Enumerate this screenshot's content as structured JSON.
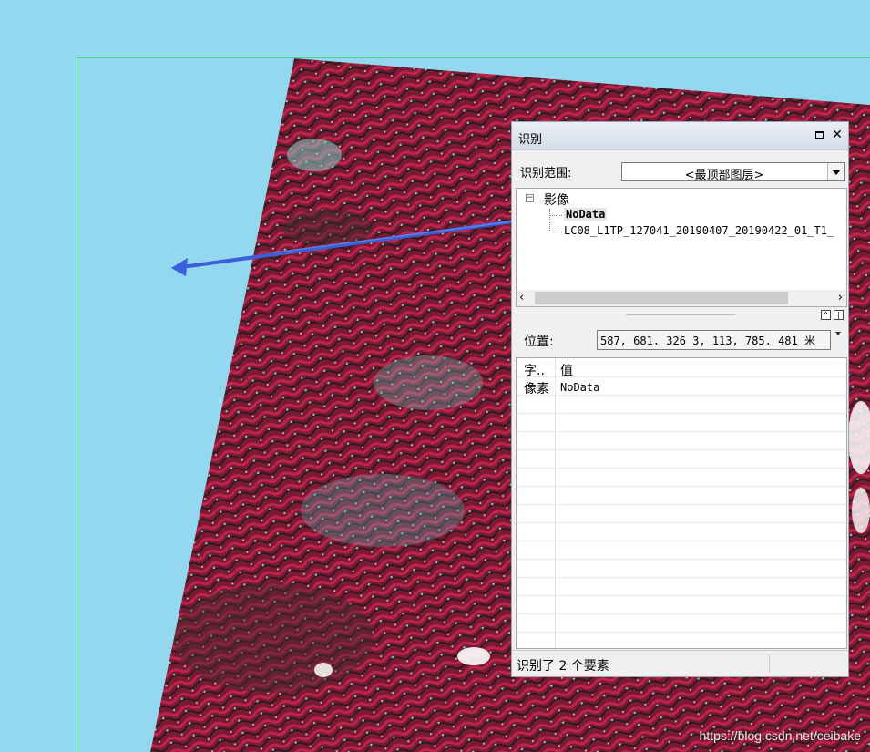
{
  "identify": {
    "title": "识别",
    "scope_label": "识别范围:",
    "scope_value": "<最顶部图层>",
    "tree": {
      "root_label": "影像",
      "nodes": [
        "NoData",
        "LC08_L1TP_127041_20190407_20190422_01_T1_"
      ]
    },
    "location_label": "位置:",
    "location_value": "587, 681. 326   3, 113, 785. 481 米",
    "table": {
      "header": {
        "field": "字..",
        "value": "值"
      },
      "rows": [
        {
          "field": "像素",
          "value": "NoData"
        }
      ]
    },
    "status_text": "识别了 2 个要素"
  },
  "watermark": "https://blog.csdn.net/ceibake",
  "icons": {
    "maximize": "maximize-icon",
    "close": "close-icon",
    "dropdown": "chevron-down-icon",
    "expander": "tree-collapse-icon",
    "scroll_left": "chevron-left-icon",
    "scroll_right": "chevron-right-icon",
    "arrow": "pointer-arrow-icon"
  },
  "colors": {
    "background": "#93d8ef",
    "extent_frame": "#37e06a",
    "imagery_dark": "#2a1a20",
    "imagery_red": "#b02045",
    "imagery_cyan": "#60c8c8",
    "arrow": "#3a5fd8"
  }
}
